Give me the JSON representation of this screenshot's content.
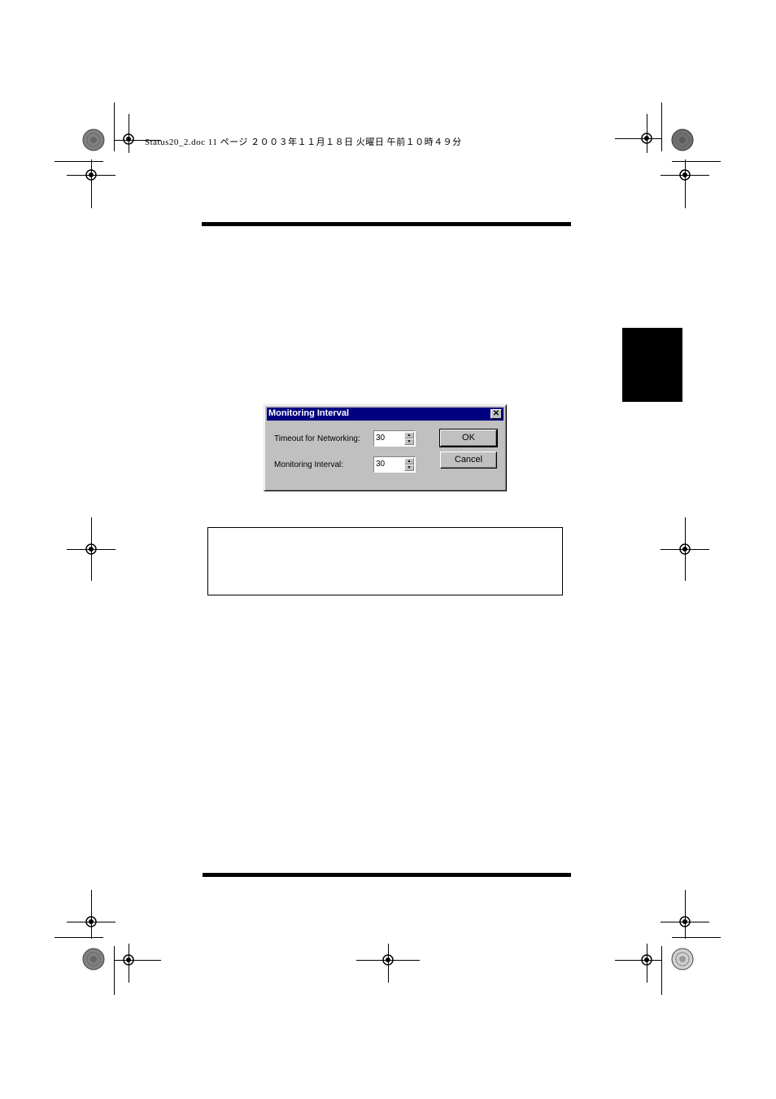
{
  "header": {
    "print_info": "Status20_2.doc  11 ページ  ２００３年１１月１８日  火曜日  午前１０時４９分"
  },
  "dialog": {
    "title": "Monitoring Interval",
    "close_icon": "close-icon",
    "timeout_label": "Timeout for Networking:",
    "timeout_value": "30",
    "interval_label": "Monitoring Interval:",
    "interval_value": "30",
    "ok_label": "OK",
    "cancel_label": "Cancel"
  }
}
